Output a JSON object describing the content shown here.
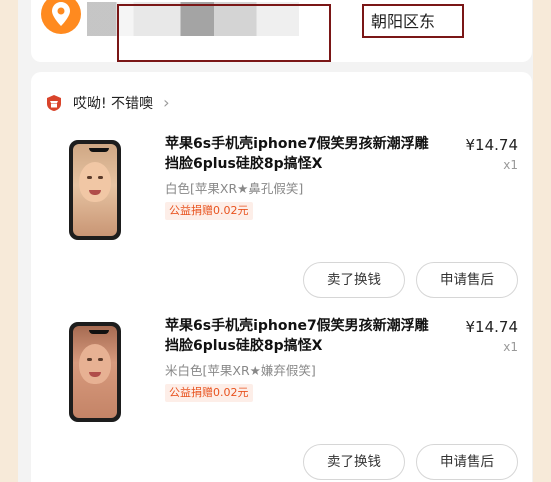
{
  "address": {
    "blurred_text": "北京市 朝阳",
    "district_text": "朝阳区东"
  },
  "store": {
    "name": "哎呦! 不错噢",
    "chevron": "›"
  },
  "items": [
    {
      "title": "苹果6s手机壳iphone7假笑男孩新潮浮雕挡脸6plus硅胶8p搞怪X",
      "spec": "白色[苹果XR★鼻孔假笑]",
      "charity": "公益捐赠0.02元",
      "price": "¥14.74",
      "qty": "x1",
      "buttons": {
        "sell": "卖了换钱",
        "aftersale": "申请售后"
      }
    },
    {
      "title": "苹果6s手机壳iphone7假笑男孩新潮浮雕挡脸6plus硅胶8p搞怪X",
      "spec": "米白色[苹果XR★嫌弃假笑]",
      "charity": "公益捐赠0.02元",
      "price": "¥14.74",
      "qty": "x1",
      "buttons": {
        "sell": "卖了换钱",
        "aftersale": "申请售后"
      }
    }
  ],
  "colors": {
    "accent_orange": "#ff8a1f",
    "charity_red": "#e8531f",
    "annotation_box": "#7a1616"
  }
}
